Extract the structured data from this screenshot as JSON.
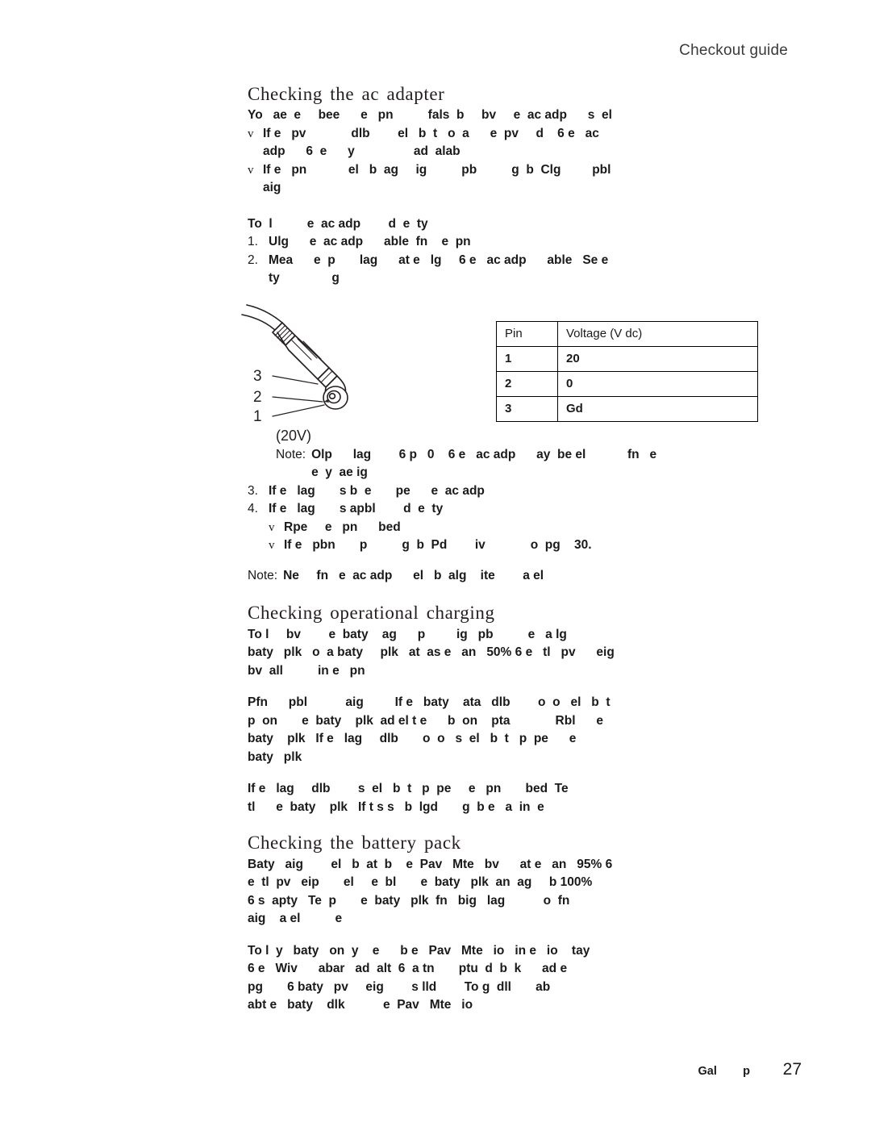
{
  "header": {
    "running_title": "Checkout guide"
  },
  "sections": {
    "ac_adapter": {
      "heading": "Checking  the  ac  adapter",
      "intro": "Yo   ae  e     bee      e   pn          fals  b     bv     e  ac adp      s  el",
      "bullets": [
        {
          "mark": "v",
          "lines": [
            "If e   pv             dlb        el   b  t   o  a      e  pv     d    6 e   ac",
            "adp      6  e      y                 ad  alab"
          ]
        },
        {
          "mark": "v",
          "lines": [
            "If e   pn            el   b  ag     ig          pb          g  b  Clg         pbl",
            "aig"
          ]
        }
      ],
      "procedure_intro": "To  l          e  ac adp        d  e  ty",
      "steps": [
        {
          "num": "1.",
          "lines": [
            "Ulg      e  ac adp      able  fn    e  pn"
          ]
        },
        {
          "num": "2.",
          "lines": [
            "Mea      e  p       lag      at e   lg     6 e   ac adp      able   Se e",
            "ty               g"
          ]
        }
      ],
      "note_after_steps": {
        "label": "Note:",
        "lines": [
          "Olp      lag        6 p   0    6 e   ac adp      ay  be el            fn   e",
          "e  y  ae ig"
        ]
      },
      "steps_cont": [
        {
          "num": "3.",
          "lines": [
            "If e   lag       s b  e       pe      e  ac adp"
          ]
        },
        {
          "num": "4.",
          "lines": [
            "If e   lag       s apbl        d  e  ty"
          ],
          "bullets": [
            {
              "mark": "v",
              "text": "Rpe     e   pn      bed"
            },
            {
              "mark": "v",
              "text": "If e   pbn       p          g  b  Pd        iv             o  pg    30."
            }
          ]
        }
      ],
      "final_note": {
        "label": "Note:",
        "text": "Ne     fn   e  ac adp      el   b  alg    ite        a el"
      }
    },
    "operational_charging": {
      "heading": "Checking  operational  charging",
      "paragraphs": [
        [
          "To l     bv        e  baty    ag      p         ig   pb          e   a lg",
          "baty   plk   o  a baty     plk   at  as e   an   50% 6 e   tl   pv      eig",
          "bv  all          in e   pn"
        ],
        [
          "Pfn      pbl           aig         If e   baty    ata   dlb        o  o   el   b  t",
          "p  on       e  baty    plk  ad el t e      b  on    pta             Rbl      e",
          "baty    plk   If e   lag     dlb       o  o   s  el   b  t   p  pe      e",
          "baty   plk"
        ],
        [
          "If e   lag     dlb        s  el   b  t   p  pe     e   pn       bed  Te",
          "tl      e  baty    plk   If t s s   b  lgd       g  b e   a  in  e"
        ]
      ]
    },
    "battery_pack": {
      "heading": "Checking  the  battery  pack",
      "paragraphs": [
        [
          "Baty   aig        el   b  at  b    e  Pav   Mte   bv      at e   an   95% 6",
          "e  tl  pv   eip       el     e  bl       e  baty   plk  an  ag     b 100%",
          "6 s  apty   Te  p       e  baty   plk  fn   big   lag           o  fn",
          "aig    a el          e"
        ],
        [
          "To l  y   baty   on  y    e      b e   Pav   Mte   io   in e   io    tay",
          "6 e   Wiv      abar   ad  alt  6  a tn       ptu  d  b  k      ad e",
          "pg       6 baty   pv     eig        s lld        To g  dll       ab",
          "abt e   baty    dlk           e  Pav   Mte   io"
        ]
      ]
    }
  },
  "pin_table": {
    "columns": [
      "Pin",
      "Voltage  (V  dc)"
    ],
    "rows": [
      [
        "1",
        "20"
      ],
      [
        "2",
        "0"
      ],
      [
        "3",
        "Gd"
      ]
    ]
  },
  "connector_figure": {
    "callouts": [
      "3",
      "2",
      "1"
    ],
    "voltage_label": "(20V)"
  },
  "footer": {
    "text": "Gal        p",
    "page_number": "27"
  }
}
